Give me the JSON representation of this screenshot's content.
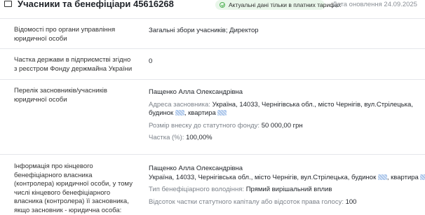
{
  "header": {
    "title": "Учасники та бенефіціари 45616268",
    "badge": "Актуальні дані тільки в платних тарифах",
    "updated": "Дата оновлення 24.09.2025"
  },
  "rows": {
    "governance": {
      "label": "Відомості про органи управління юридичної особи",
      "value": "Загальні збори учасників; Директор"
    },
    "state_share": {
      "label": "Частка держави в підприємстві згідно з реєстром Фонду держмайна України",
      "value": "0"
    },
    "founders": {
      "label": "Перелік засновників/учасників юридичної особи",
      "name": "Пащенко Алла Олександрівна",
      "address_label": "Адреса засновника:",
      "address_line1": "Україна, 14033, Чернігівська обл., місто Чернігів, вул.Стрілецька,",
      "address_line2_prefix": "будинок",
      "address_line2_mid": ", квартира",
      "capital_label": "Розмір внеску до статутного фонду:",
      "capital_value": "50 000,00 грн",
      "share_label": "Частка (%):",
      "share_value": "100,00%"
    },
    "beneficiary": {
      "label": "Інформація про кінцевого бенефіціарного власника (контролера) юридичної особи, у тому числі кінцевого бенефіціарного власника (контролера) її засновника, якщо засновник - юридична особа:",
      "name": "Пащенко Алла Олександрівна",
      "address_prefix": "Україна, 14033, Чернігівська обл., місто Чернігів, вул.Стрілецька, будинок",
      "address_mid": ", квартира",
      "type_label": "Тип бенефіціарного володіння:",
      "type_value": "Прямий вирішальний вплив",
      "percent_label": "Відсоток частки статутного капіталу або відсоток права голосу:",
      "percent_value": "100"
    }
  },
  "colors": {
    "badge_bg": "#e9f6ea",
    "badge_icon": "#4caf50",
    "masked_value": "#a8c4ea"
  }
}
